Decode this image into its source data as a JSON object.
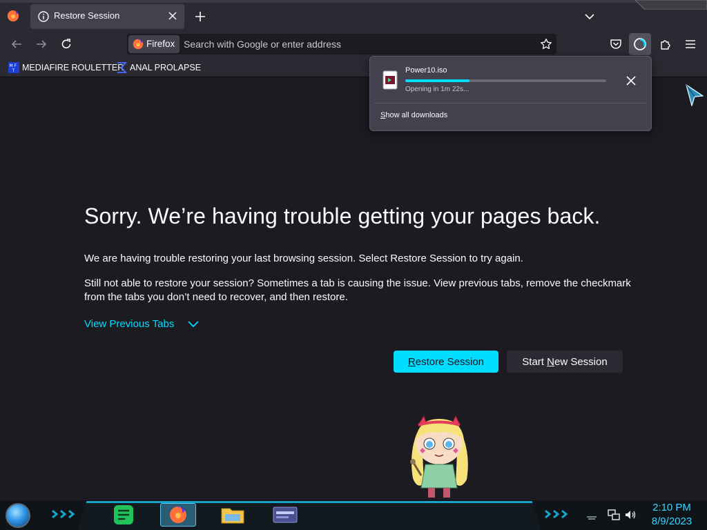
{
  "tab": {
    "title": "Restore Session"
  },
  "urlbar": {
    "identity_label": "Firefox",
    "placeholder": "Search with Google or enter address"
  },
  "bookmarks": [
    {
      "label": "MEDIAFIRE ROULETTER",
      "icon": "mediafire-favicon"
    },
    {
      "label": "ANAL PROLAPSE",
      "icon": "sigma-favicon"
    }
  ],
  "page": {
    "title": "Sorry. We’re having trouble getting your pages back.",
    "p1": "We are having trouble restoring your last browsing session. Select Restore Session to try again.",
    "p2": "Still not able to restore your session? Sometimes a tab is causing the issue. View previous tabs, remove the checkmark from the tabs you don’t need to recover, and then restore.",
    "view_previous": "View Previous Tabs",
    "restore_pre": "",
    "restore_key": "R",
    "restore_post": "estore Session",
    "newsession_pre": "Start ",
    "newsession_key": "N",
    "newsession_post": "ew Session"
  },
  "downloads": {
    "filename": "Power10.iso",
    "status": "Opening in 1m 22s...",
    "progress_fraction": 0.32,
    "show_all_key": "S",
    "show_all_rest": "how all downloads"
  },
  "clock": {
    "time": "2:10 PM",
    "date": "8/9/2023"
  },
  "colors": {
    "accent": "#00ddff",
    "background": "#1c1b22",
    "toolbar": "#2b2a33",
    "clock": "#38d4ff"
  }
}
